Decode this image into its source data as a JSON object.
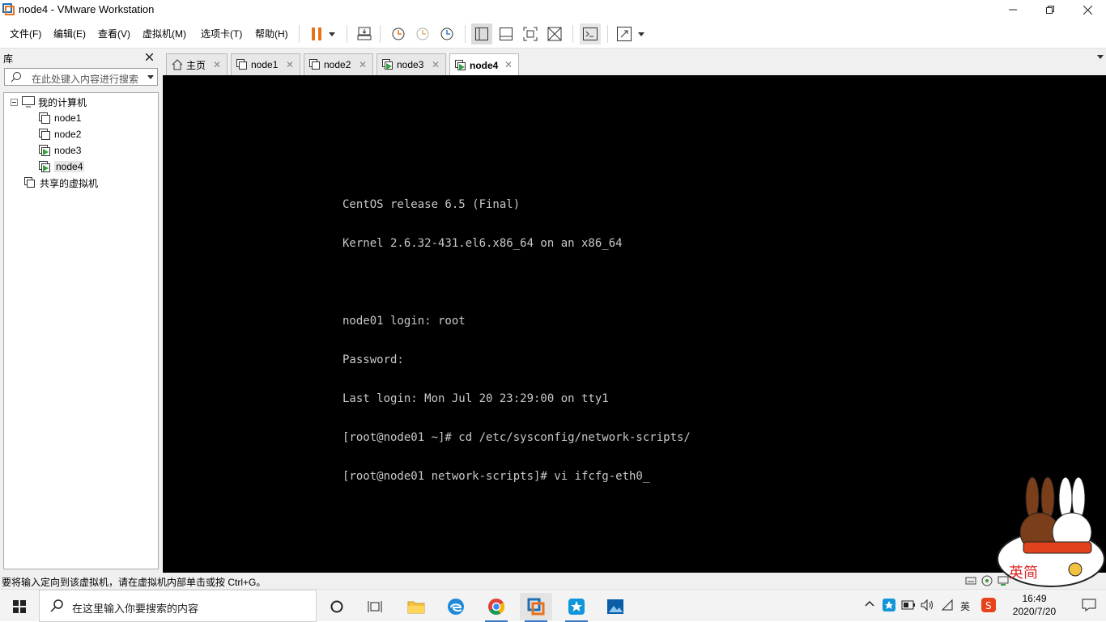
{
  "window": {
    "title": "node4 - VMware Workstation"
  },
  "menu": [
    "文件(F)",
    "编辑(E)",
    "查看(V)",
    "虚拟机(M)",
    "选项卡(T)",
    "帮助(H)"
  ],
  "library": {
    "title": "库",
    "search_placeholder": "在此处键入内容进行搜索",
    "root": "我的计算机",
    "vms": [
      "node1",
      "node2",
      "node3",
      "node4"
    ],
    "shared": "共享的虚拟机",
    "selected": "node4"
  },
  "tabs": [
    {
      "label": "主页",
      "icon": "home-icon"
    },
    {
      "label": "node1",
      "icon": "vm-icon"
    },
    {
      "label": "node2",
      "icon": "vm-icon"
    },
    {
      "label": "node3",
      "icon": "vm-running-icon"
    },
    {
      "label": "node4",
      "icon": "vm-running-icon",
      "active": true
    }
  ],
  "terminal": {
    "lines": [
      "CentOS release 6.5 (Final)",
      "Kernel 2.6.32-431.el6.x86_64 on an x86_64",
      "",
      "node01 login: root",
      "Password:",
      "Last login: Mon Jul 20 23:29:00 on tty1",
      "[root@node01 ~]# cd /etc/sysconfig/network-scripts/",
      "[root@node01 network-scripts]# vi ifcfg-eth0_"
    ]
  },
  "status": {
    "message": "要将输入定向到该虚拟机，请在虚拟机内部单击或按 Ctrl+G。"
  },
  "taskbar": {
    "search_placeholder": "在这里输入你要搜索的内容",
    "ime": "英",
    "time": "16:49",
    "date": "2020/7/20"
  },
  "watermark": {
    "text": "英简"
  },
  "colors": {
    "accent_orange": "#e8711c",
    "selection_blue": "#3a78c8",
    "console_bg": "#000000"
  }
}
